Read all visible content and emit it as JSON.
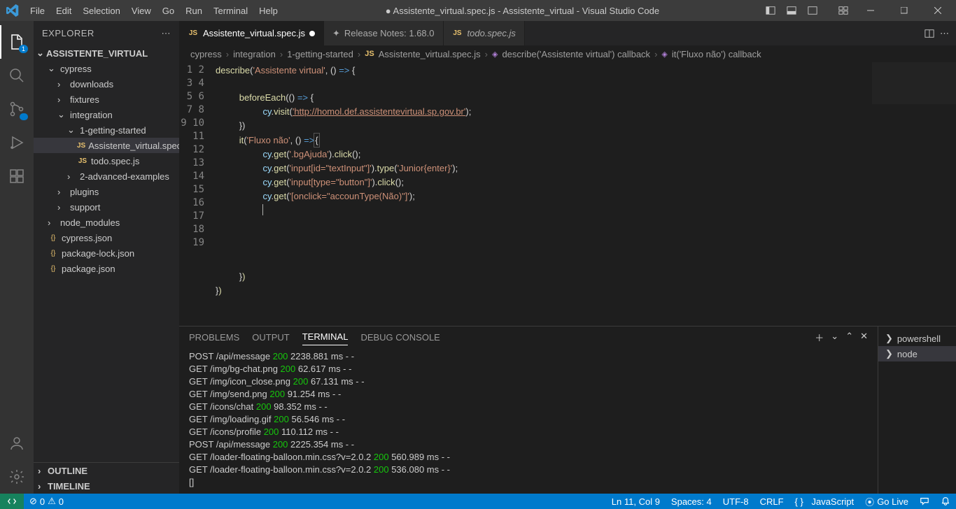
{
  "titlebar": {
    "menu": [
      "File",
      "Edit",
      "Selection",
      "View",
      "Go",
      "Run",
      "Terminal",
      "Help"
    ],
    "title": "● Assistente_virtual.spec.js - Assistente_virtual - Visual Studio Code"
  },
  "activity": {
    "badge_explorer": "1"
  },
  "sidebar": {
    "title": "EXPLORER",
    "root": "ASSISTENTE_VIRTUAL",
    "tree": {
      "cypress": "cypress",
      "downloads": "downloads",
      "fixtures": "fixtures",
      "integration": "integration",
      "getting": "1-getting-started",
      "file1": "Assistente_virtual.spec.js",
      "file2": "todo.spec.js",
      "advanced": "2-advanced-examples",
      "plugins": "plugins",
      "support": "support",
      "node_modules": "node_modules",
      "cypress_json": "cypress.json",
      "package_lock": "package-lock.json",
      "package_json": "package.json"
    },
    "outline": "OUTLINE",
    "timeline": "TIMELINE"
  },
  "tabs": {
    "t1": "Assistente_virtual.spec.js",
    "t2": "Release Notes: 1.68.0",
    "t3": "todo.spec.js"
  },
  "breadcrumb": {
    "p1": "cypress",
    "p2": "integration",
    "p3": "1-getting-started",
    "p4": "Assistente_virtual.spec.js",
    "p5": "describe('Assistente virtual') callback",
    "p6": "it('Fluxo não') callback"
  },
  "code": {
    "describe": "describe",
    "desc_str": "'Assistente virtual'",
    "beforeEach": "beforeEach",
    "cy": "cy",
    "visit": "visit",
    "url": "'http://homol.def.assistentevirtual.sp.gov.br'",
    "it": "it",
    "it_str": "'Fluxo não'",
    "get": "get",
    "click": "click",
    "type": "type",
    "sel_bgAjuda": "'.bgAjuda'",
    "sel_textInput": "'input[id=\"textInput\"]'",
    "type_val": "'Junior{enter}'",
    "sel_button": "'input[type=\"button\"]'",
    "sel_onclick": "'[onclick=\"accounType(Não)\"]'"
  },
  "panel": {
    "tabs": {
      "problems": "PROBLEMS",
      "output": "OUTPUT",
      "terminal": "TERMINAL",
      "debug": "DEBUG CONSOLE"
    },
    "instances": {
      "ps": "powershell",
      "node": "node"
    },
    "log": [
      {
        "m": "POST",
        "p": "/api/message",
        "s": "200",
        "r": "2238.881 ms - -"
      },
      {
        "m": "GET",
        "p": "/img/bg-chat.png",
        "s": "200",
        "r": "62.617 ms - -"
      },
      {
        "m": "GET",
        "p": "/img/icon_close.png",
        "s": "200",
        "r": "67.131 ms - -"
      },
      {
        "m": "GET",
        "p": "/img/send.png",
        "s": "200",
        "r": "91.254 ms - -"
      },
      {
        "m": "GET",
        "p": "/icons/chat",
        "s": "200",
        "r": "98.352 ms - -"
      },
      {
        "m": "GET",
        "p": "/img/loading.gif",
        "s": "200",
        "r": "56.546 ms - -"
      },
      {
        "m": "GET",
        "p": "/icons/profile",
        "s": "200",
        "r": "110.112 ms - -"
      },
      {
        "m": "POST",
        "p": "/api/message",
        "s": "200",
        "r": "2225.354 ms - -"
      },
      {
        "m": "GET",
        "p": "/loader-floating-balloon.min.css?v=2.0.2",
        "s": "200",
        "r": "560.989 ms - -"
      },
      {
        "m": "GET",
        "p": "/loader-floating-balloon.min.css?v=2.0.2",
        "s": "200",
        "r": "536.080 ms - -"
      }
    ],
    "prompt": "[]"
  },
  "status": {
    "errors": "0",
    "warnings": "0",
    "lncol": "Ln 11, Col 9",
    "spaces": "Spaces: 4",
    "encoding": "UTF-8",
    "eol": "CRLF",
    "lang": "JavaScript",
    "golive": "Go Live"
  }
}
